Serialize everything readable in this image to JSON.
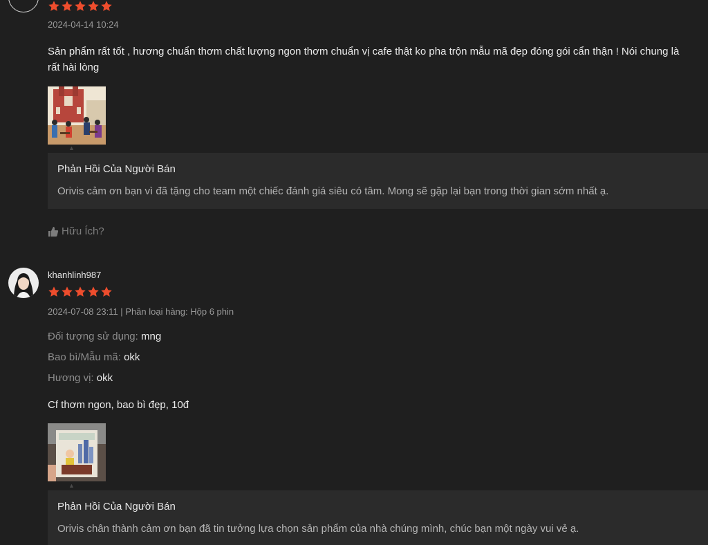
{
  "review1": {
    "date": "2024-04-14 10:24",
    "rating": 5,
    "comment": "Sản phẩm rất tốt , hương chuẩn thơm chất lượng ngon thơm chuẩn vị cafe thật ko pha trộn mẫu mã đẹp đóng gói cẩn thận ! Nói chung là rất hài lòng",
    "seller_reply": {
      "title": "Phản Hồi Của Người Bán",
      "body": "Orivis cảm ơn bạn vì đã tặng cho team một chiếc đánh giá siêu có tâm. Mong sẽ gặp lại bạn trong thời gian sớm nhất ạ."
    },
    "helpful_label": "Hữu Ích?"
  },
  "review2": {
    "username": "khanhlinh987",
    "rating": 5,
    "meta": "2024-07-08 23:11 | Phân loại hàng: Hộp 6 phin",
    "attributes": [
      {
        "key": "Đối tượng sử dụng:",
        "value": "mng"
      },
      {
        "key": "Bao bì/Mẫu mã:",
        "value": "okk"
      },
      {
        "key": "Hương vị:",
        "value": "okk"
      }
    ],
    "comment": "Cf thơm ngon, bao bì đẹp, 10đ",
    "seller_reply": {
      "title": "Phản Hồi Của Người Bán",
      "body": "Orivis chân thành cảm ơn bạn đã tin tưởng lựa chọn sản phẩm của nhà chúng mình, chúc bạn một ngày vui vẻ ạ."
    }
  },
  "colors": {
    "star": "#ee4d2d",
    "background": "#1f1f1f",
    "reply_bg": "#2b2b2b"
  },
  "icons": [
    "star-icon",
    "thumbs-up-icon",
    "caret-up-icon"
  ]
}
